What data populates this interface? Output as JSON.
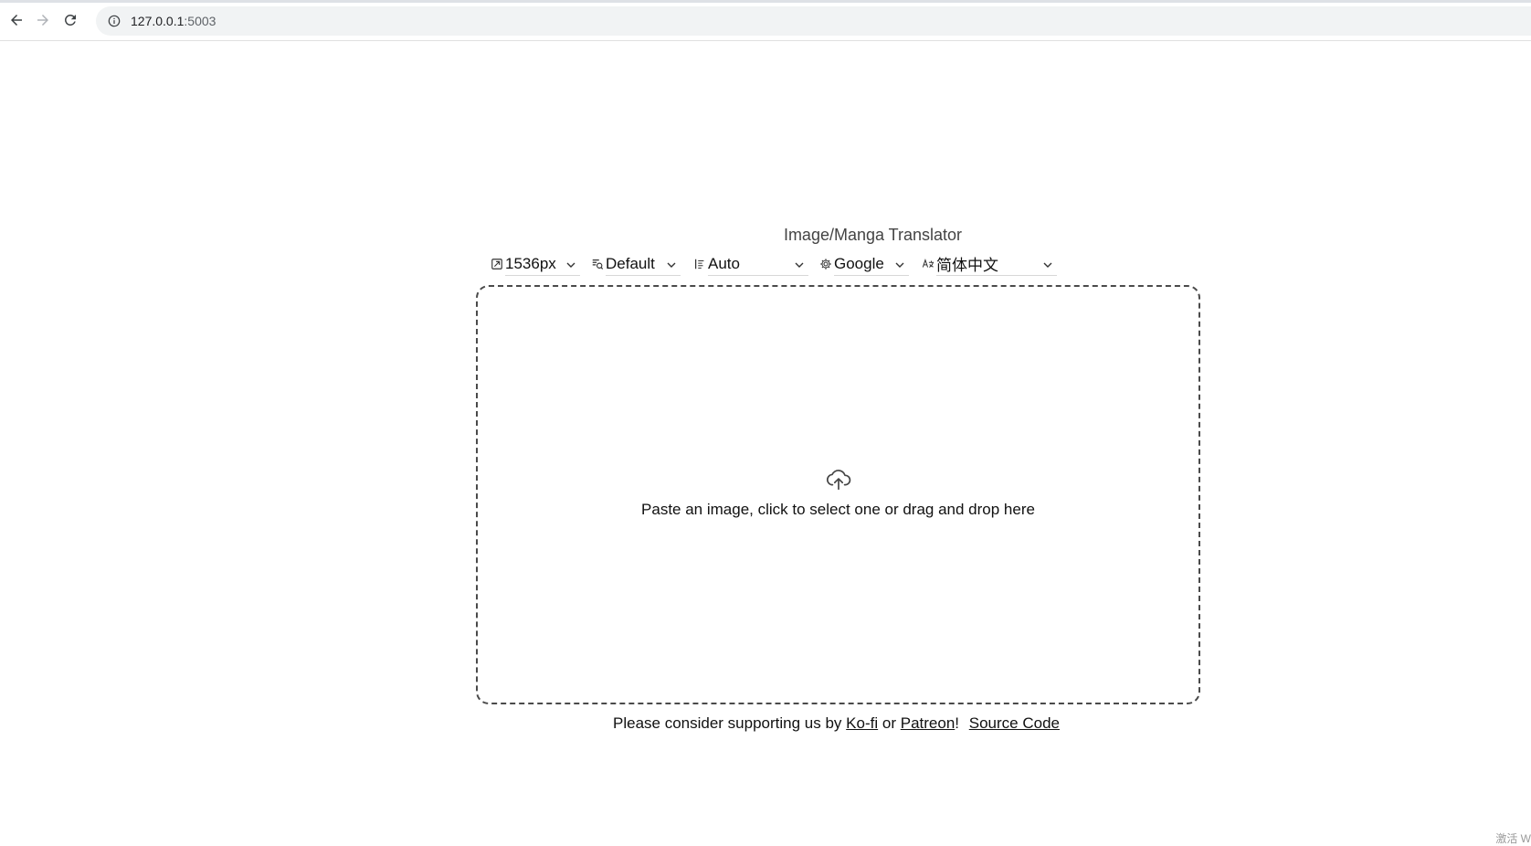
{
  "browser": {
    "url_host": "127.0.0.1",
    "url_port": ":5003"
  },
  "app": {
    "title": "Image/Manga Translator",
    "selects": {
      "size": "1536px",
      "detector": "Default",
      "direction": "Auto",
      "translator": "Google",
      "target_language": "简体中文"
    },
    "dropzone_text": "Paste an image, click to select one or drag and drop here",
    "footer": {
      "prefix": "Please consider supporting us by",
      "kofi": "Ko-fi",
      "or": "or",
      "patreon": "Patreon",
      "exclaim": "!",
      "source_code": "Source Code"
    }
  },
  "corner_text": "激活 W"
}
